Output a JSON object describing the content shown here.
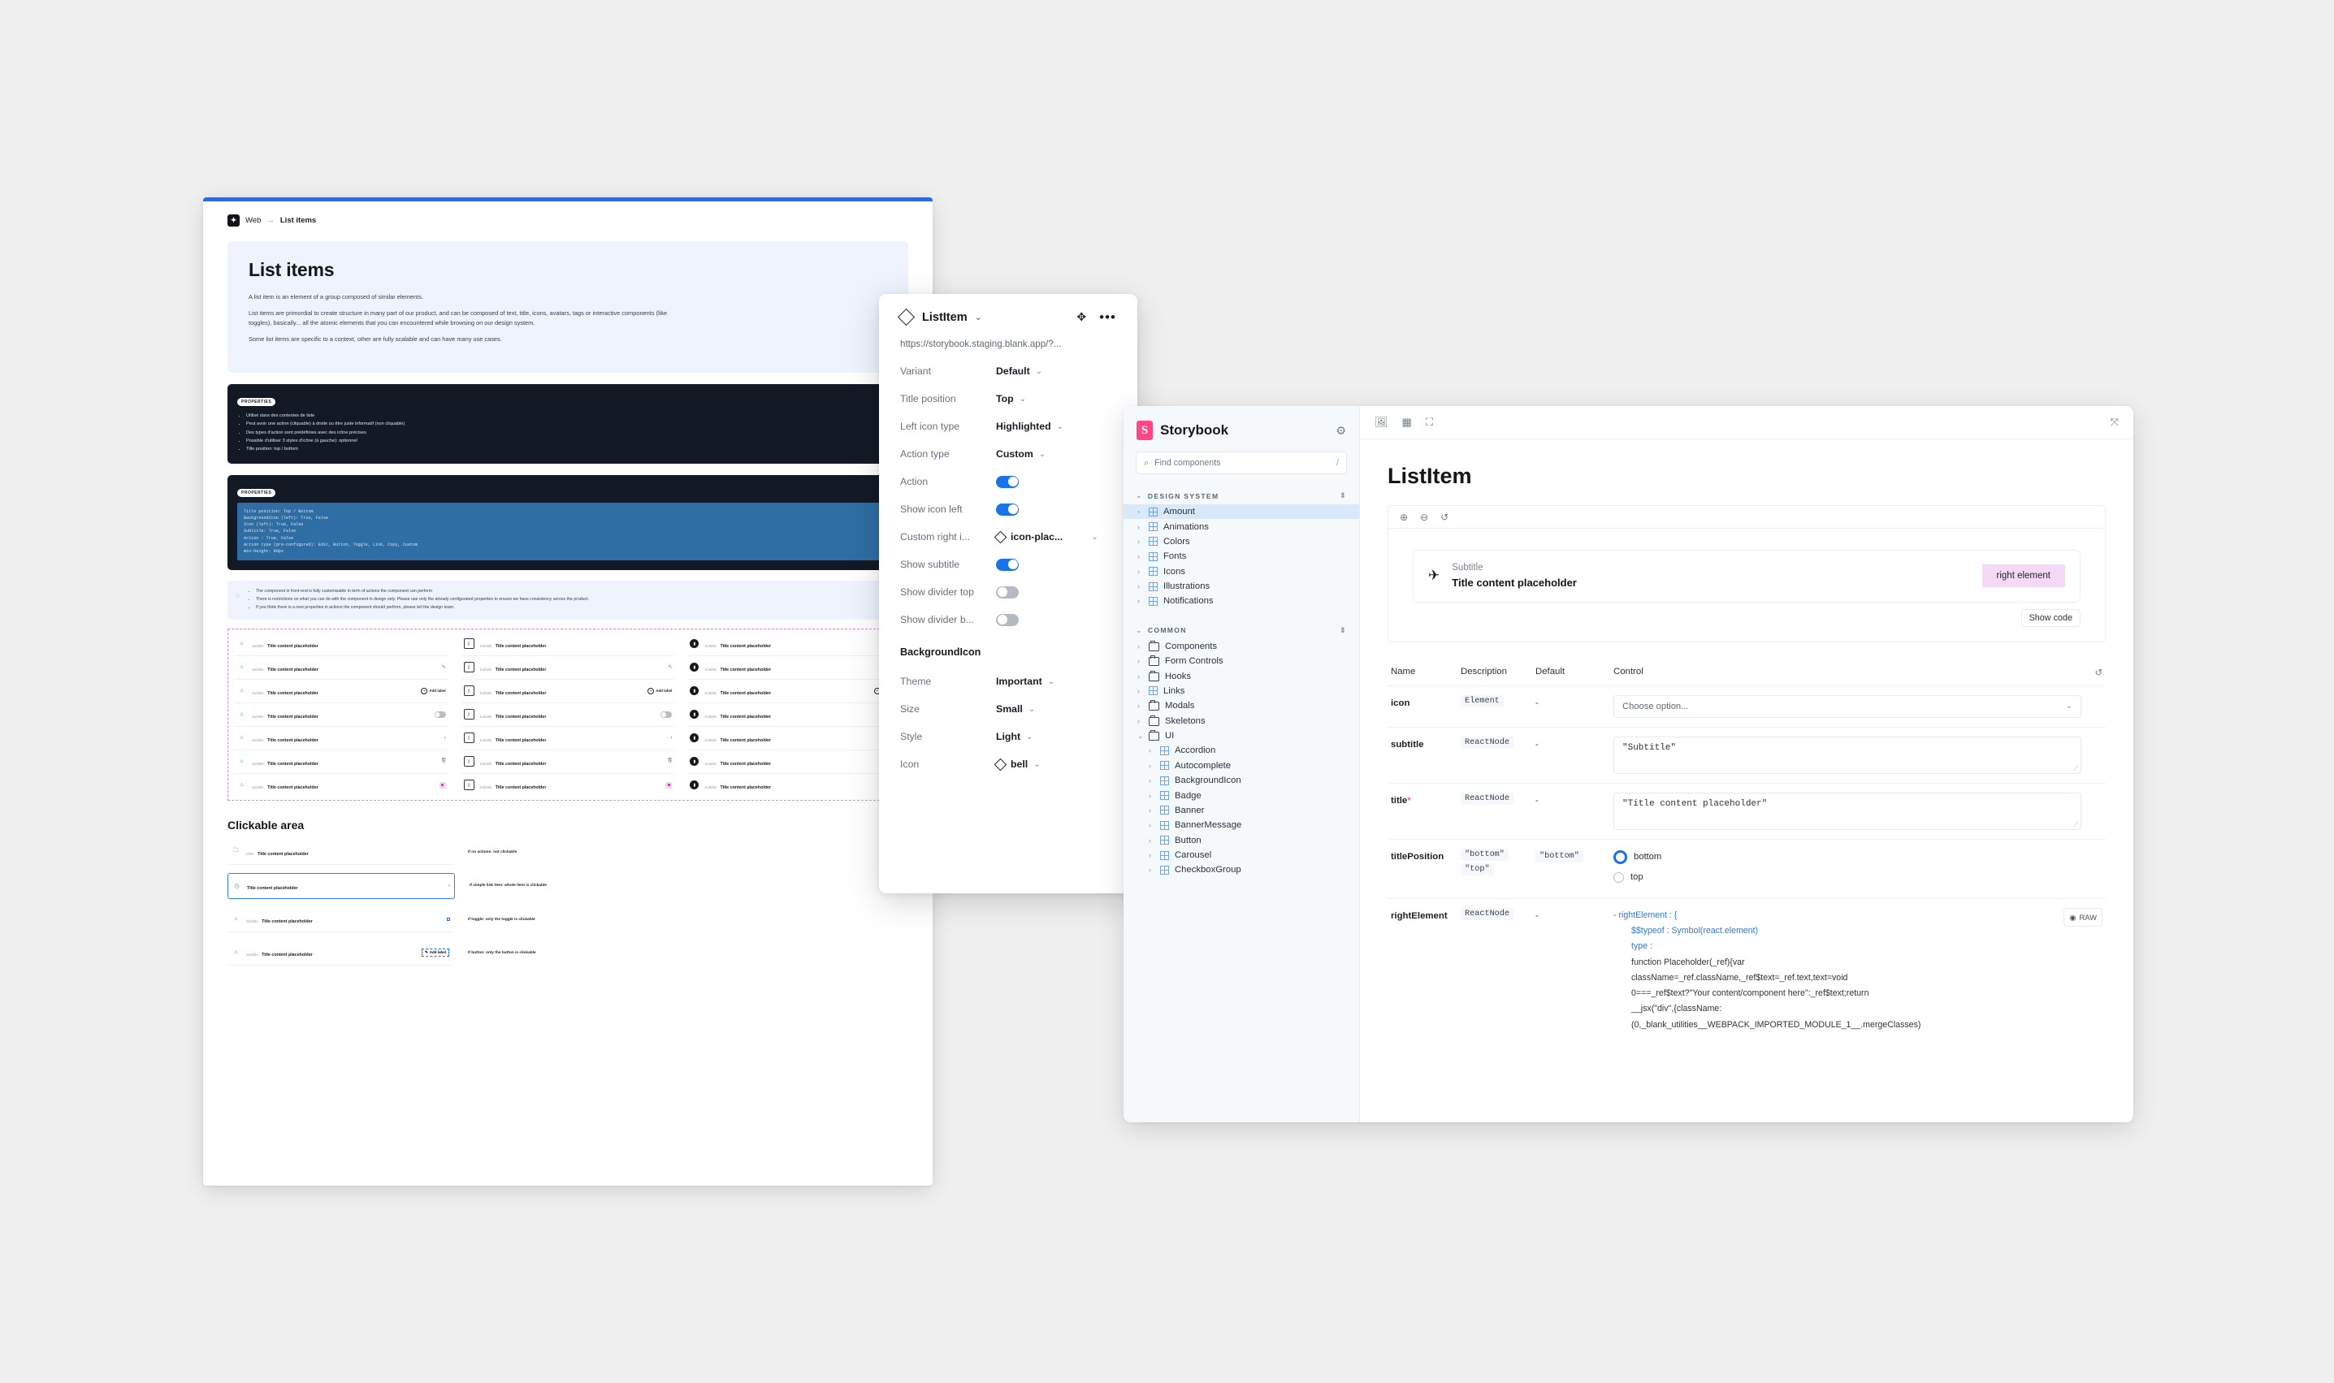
{
  "figma_doc": {
    "breadcrumb": {
      "root": "Web",
      "separator": "→",
      "current": "List items"
    },
    "hero": {
      "title": "List items",
      "paragraphs": [
        "A list item is an element of a group composed of similar elements.",
        "List items are primordial to create structure in many part of our product, and can be composed of text, title, icons, avatars, tags or interactive components (like toggles), basically... all the atomic elements that you can encountered while browsing on our design system.",
        "Some list items are specific to a context, other are fully scalable and can have many use cases."
      ]
    },
    "properties_block_1": {
      "tag": "PROPERTIES",
      "bullets": [
        "Utilisé dans des contextes de liste",
        "Peut avoir une action (cliquable) à droite ou être juste informatif (non cliquable)",
        "Des types d'action sont prédéfinies avec des icône précises",
        "Possible d'utiliser 3 styles d'icône (à gauche): optionnel",
        "Title position: top / bottom"
      ]
    },
    "properties_block_2": {
      "tag": "PROPERTIES",
      "code": "Title position: Top / Bottom\nBackgroundIcon (left): True, False\nIcon (left): True, False\nSubtitle: True, False\nAction : True, False\nAction type (pre-configured): Edit, Button, Toggle, Link, Copy, Custom\nmin-height: 80px"
    },
    "note": {
      "bullets": [
        "The component in front-end is fully customisable in term of actions the component can perform",
        "There is restrictions on what you can do with the component in design only. Please use only the already configurated properties to ensure we have consistency across the product.",
        "If you think there is a new properties in actions the component should perform, please tell the design team."
      ]
    },
    "sample_rows": {
      "subtitle": "Subtitle",
      "title": "Title content placeholder",
      "add_label": "Add label",
      "icon_variants": [
        "bell",
        "box",
        "dark-avatar"
      ],
      "right_variants": [
        "none",
        "pencil",
        "add-label",
        "toggle",
        "chevron",
        "copy",
        "pink-dot"
      ]
    },
    "clickable_area": {
      "heading": "Clickable area",
      "rows": [
        {
          "subtitle": "Offer",
          "title": "Title content placeholder",
          "note": "If no actions: not clickable",
          "right": "none",
          "icon": "folder"
        },
        {
          "subtitle": "",
          "title": "Title content placeholder",
          "note": "If simple link item: whole item is clickable",
          "right": "chevron",
          "icon": "clock"
        },
        {
          "subtitle": "Subtitle",
          "title": "Title content placeholder",
          "note": "If toggle: only the toggle is clickable",
          "right": "toggle",
          "icon": "bell"
        },
        {
          "subtitle": "Subtitle",
          "title": "Title content placeholder",
          "note": "If button: only the button is clickable",
          "right": "button",
          "icon": "bell",
          "button_label": "Add label"
        }
      ]
    }
  },
  "props_panel": {
    "component_name": "ListItem",
    "url": "https://storybook.staging.blank.app/?...",
    "move_icon": "move-icon",
    "more_icon": "more-icon",
    "rows": [
      {
        "label": "Variant",
        "value": "Default",
        "type": "select"
      },
      {
        "label": "Title position",
        "value": "Top",
        "type": "select"
      },
      {
        "label": "Left icon type",
        "value": "Highlighted",
        "type": "select"
      },
      {
        "label": "Action type",
        "value": "Custom",
        "type": "select"
      },
      {
        "label": "Action",
        "value": "on",
        "type": "toggle"
      },
      {
        "label": "Show icon left",
        "value": "on",
        "type": "toggle"
      },
      {
        "label": "Custom right i...",
        "value": "icon-plac...",
        "type": "instance"
      },
      {
        "label": "Show subtitle",
        "value": "on",
        "type": "toggle"
      },
      {
        "label": "Show divider top",
        "value": "off",
        "type": "toggle"
      },
      {
        "label": "Show divider b...",
        "value": "off",
        "type": "toggle"
      }
    ],
    "section_title": "BackgroundIcon",
    "section_rows": [
      {
        "label": "Theme",
        "value": "Important",
        "type": "select"
      },
      {
        "label": "Size",
        "value": "Small",
        "type": "select"
      },
      {
        "label": "Style",
        "value": "Light",
        "type": "select"
      },
      {
        "label": "Icon",
        "value": "bell",
        "type": "instance"
      }
    ]
  },
  "storybook": {
    "brand": "Storybook",
    "gear_icon": "gear-icon",
    "search": {
      "placeholder": "Find components",
      "shortcut": "/"
    },
    "groups": [
      {
        "label": "DESIGN SYSTEM",
        "items": [
          {
            "label": "Amount",
            "type": "component",
            "selected": true
          },
          {
            "label": "Animations",
            "type": "component"
          },
          {
            "label": "Colors",
            "type": "component"
          },
          {
            "label": "Fonts",
            "type": "component"
          },
          {
            "label": "Icons",
            "type": "component"
          },
          {
            "label": "Illustrations",
            "type": "component"
          },
          {
            "label": "Notifications",
            "type": "component"
          }
        ]
      },
      {
        "label": "COMMON",
        "items": [
          {
            "label": "Components",
            "type": "folder"
          },
          {
            "label": "Form Controls",
            "type": "folder"
          },
          {
            "label": "Hooks",
            "type": "folder"
          },
          {
            "label": "Links",
            "type": "component"
          },
          {
            "label": "Modals",
            "type": "folder"
          },
          {
            "label": "Skeletons",
            "type": "folder"
          },
          {
            "label": "UI",
            "type": "folder",
            "expanded": true
          },
          {
            "label": "Accordion",
            "type": "component",
            "indent": true
          },
          {
            "label": "Autocomplete",
            "type": "component",
            "indent": true
          },
          {
            "label": "BackgroundIcon",
            "type": "component",
            "indent": true
          },
          {
            "label": "Badge",
            "type": "component",
            "indent": true
          },
          {
            "label": "Banner",
            "type": "component",
            "indent": true
          },
          {
            "label": "BannerMessage",
            "type": "component",
            "indent": true
          },
          {
            "label": "Button",
            "type": "component",
            "indent": true
          },
          {
            "label": "Carousel",
            "type": "component",
            "indent": true
          },
          {
            "label": "CheckboxGroup",
            "type": "component",
            "indent": true
          }
        ]
      }
    ],
    "toolbar": {
      "icons": [
        "image-icon",
        "grid-icon",
        "measure-icon"
      ],
      "expand_icon": "expand-icon"
    },
    "page_title": "ListItem",
    "preview": {
      "tools": [
        "zoom-in-icon",
        "zoom-out-icon",
        "zoom-reset-icon"
      ],
      "item": {
        "left_icon": "plane-icon",
        "subtitle": "Subtitle",
        "title": "Title content placeholder",
        "right_element": "right element"
      },
      "show_code": "Show code"
    },
    "controls": {
      "headers": [
        "Name",
        "Description",
        "Default",
        "Control"
      ],
      "reset_icon": "reset-icon",
      "rows": [
        {
          "name": "icon",
          "required": false,
          "description": [
            "Element"
          ],
          "default": "-",
          "control_type": "select",
          "control_value": "Choose option..."
        },
        {
          "name": "subtitle",
          "required": false,
          "description": [
            "ReactNode"
          ],
          "default": "-",
          "control_type": "textarea",
          "control_value": "\"Subtitle\""
        },
        {
          "name": "title",
          "required": true,
          "description": [
            "ReactNode"
          ],
          "default": "-",
          "control_type": "textarea",
          "control_value": "\"Title content placeholder\""
        },
        {
          "name": "titlePosition",
          "required": false,
          "description": [
            "\"bottom\"",
            "\"top\""
          ],
          "default": "\"bottom\"",
          "control_type": "radio",
          "options": [
            {
              "label": "bottom",
              "selected": true
            },
            {
              "label": "top",
              "selected": false
            }
          ]
        },
        {
          "name": "rightElement",
          "required": false,
          "description": [
            "ReactNode"
          ],
          "default": "-",
          "control_type": "object",
          "raw_label": "RAW",
          "object_lines": [
            "rightElement : {",
            "$$typeof : Symbol(react.element)",
            "type :",
            "function Placeholder(_ref){var",
            "className=_ref.className,_ref$text=_ref.text,text=void",
            "0===_ref$text?\"Your content/component here\":_ref$text;return",
            "__jsx(\"div\",{className:",
            "(0,_blank_utilities__WEBPACK_IMPORTED_MODULE_1__.mergeClasses)"
          ]
        }
      ]
    }
  },
  "colors": {
    "accent_blue": "#1a6dff",
    "storybook_pink": "#ff4785",
    "page_bg": "#f0f0f0",
    "right_element_bg": "#f6d8f7",
    "selected_sidebar": "#d9e8fb"
  }
}
